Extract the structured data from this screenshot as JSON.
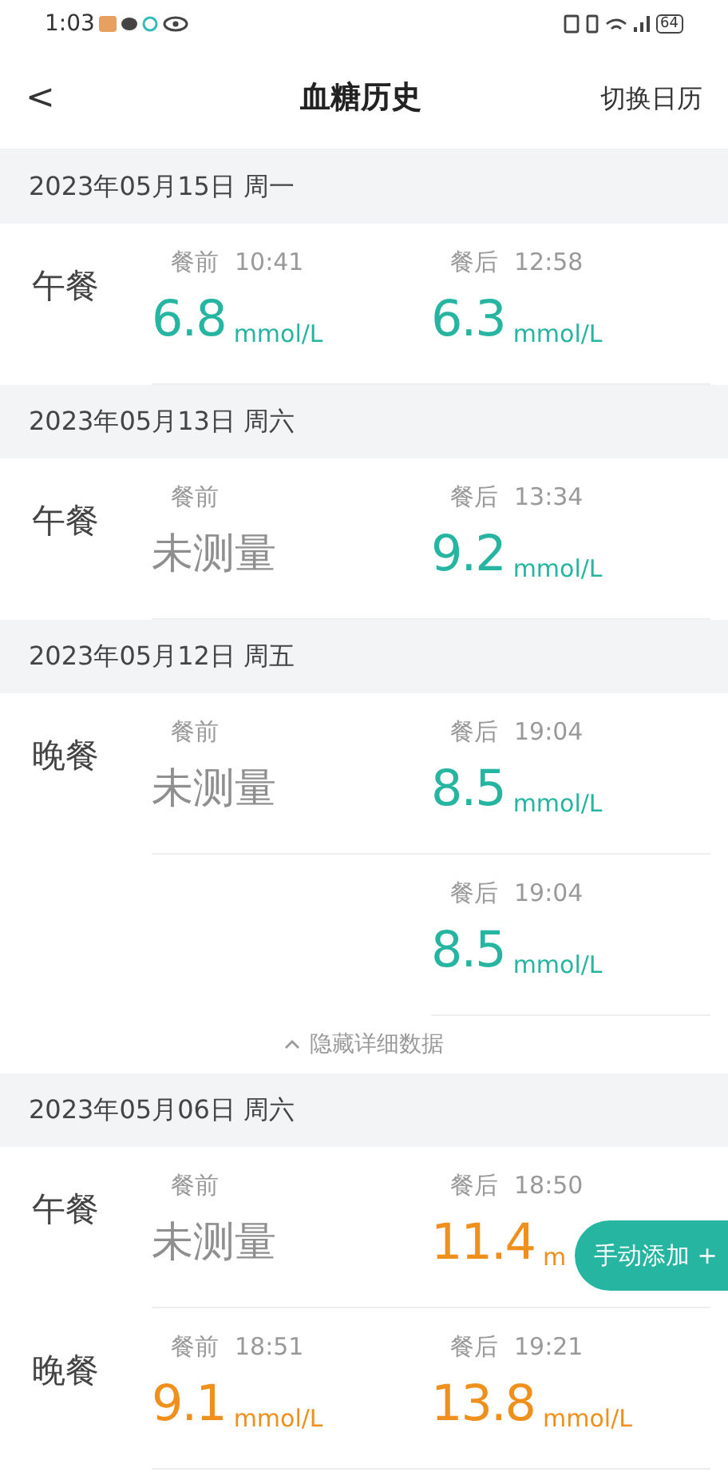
{
  "status_bar": {
    "time": "1:03",
    "battery": "64"
  },
  "header": {
    "back": "<",
    "title": "血糖历史",
    "action": "切换日历"
  },
  "days": [
    {
      "date": "2023年05月15日 周一",
      "meals": [
        {
          "name": "午餐",
          "rows": [
            {
              "before": {
                "label": "餐前",
                "time": "10:41",
                "value": "6.8",
                "unit": "mmol/L",
                "kind": "normal"
              },
              "after": {
                "label": "餐后",
                "time": "12:58",
                "value": "6.3",
                "unit": "mmol/L",
                "kind": "normal"
              }
            }
          ]
        }
      ]
    },
    {
      "date": "2023年05月13日 周六",
      "meals": [
        {
          "name": "午餐",
          "rows": [
            {
              "before": {
                "label": "餐前",
                "value": "未测量",
                "kind": "missing"
              },
              "after": {
                "label": "餐后",
                "time": "13:34",
                "value": "9.2",
                "unit": "mmol/L",
                "kind": "normal"
              }
            }
          ]
        }
      ]
    },
    {
      "date": "2023年05月12日 周五",
      "meals": [
        {
          "name": "晚餐",
          "rows": [
            {
              "before": {
                "label": "餐前",
                "value": "未测量",
                "kind": "missing"
              },
              "after": {
                "label": "餐后",
                "time": "19:04",
                "value": "8.5",
                "unit": "mmol/L",
                "kind": "normal"
              }
            },
            {
              "after": {
                "label": "餐后",
                "time": "19:04",
                "value": "8.5",
                "unit": "mmol/L",
                "kind": "normal"
              }
            }
          ]
        }
      ],
      "toggle": {
        "label": "隐藏详细数据",
        "expanded": true
      }
    },
    {
      "date": "2023年05月06日 周六",
      "meals": [
        {
          "name": "午餐",
          "rows": [
            {
              "before": {
                "label": "餐前",
                "value": "未测量",
                "kind": "missing"
              },
              "after": {
                "label": "餐后",
                "time": "18:50",
                "value": "11.4",
                "unit": "m",
                "kind": "high"
              }
            }
          ]
        },
        {
          "name": "晚餐",
          "rows": [
            {
              "before": {
                "label": "餐前",
                "time": "18:51",
                "value": "9.1",
                "unit": "mmol/L",
                "kind": "high"
              },
              "after": {
                "label": "餐后",
                "time": "19:21",
                "value": "13.8",
                "unit": "mmol/L",
                "kind": "high"
              }
            }
          ]
        }
      ]
    }
  ],
  "fab": {
    "label": "手动添加 +"
  }
}
